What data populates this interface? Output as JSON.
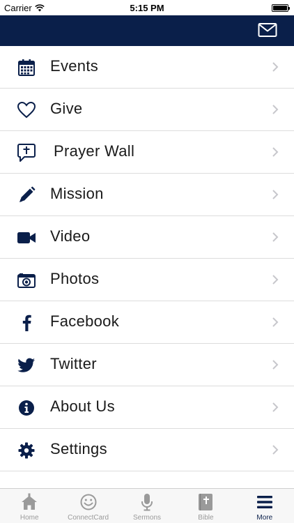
{
  "status_bar": {
    "carrier": "Carrier",
    "time": "5:15 PM"
  },
  "nav": {
    "mail_icon": "envelope-icon",
    "bar_color": "#0a1f4a"
  },
  "menu": {
    "items": [
      {
        "label": "Events",
        "icon": "calendar-icon"
      },
      {
        "label": "Give",
        "icon": "heart-icon"
      },
      {
        "label": "Prayer Wall",
        "icon": "prayer-bubble-icon"
      },
      {
        "label": "Mission",
        "icon": "pencil-icon"
      },
      {
        "label": "Video",
        "icon": "video-camera-icon"
      },
      {
        "label": "Photos",
        "icon": "camera-icon"
      },
      {
        "label": "Facebook",
        "icon": "facebook-icon"
      },
      {
        "label": "Twitter",
        "icon": "twitter-icon"
      },
      {
        "label": "About Us",
        "icon": "info-icon"
      },
      {
        "label": "Settings",
        "icon": "gear-icon"
      }
    ]
  },
  "tabs": {
    "items": [
      {
        "label": "Home",
        "icon": "home-icon"
      },
      {
        "label": "ConnectCard",
        "icon": "smiley-icon"
      },
      {
        "label": "Sermons",
        "icon": "microphone-icon"
      },
      {
        "label": "Bible",
        "icon": "bible-icon"
      },
      {
        "label": "More",
        "icon": "menu-icon",
        "active": true
      }
    ]
  },
  "colors": {
    "accent": "#0a1f4a",
    "inactive_tab": "#9a9a9a",
    "divider": "#dcdcdc"
  }
}
